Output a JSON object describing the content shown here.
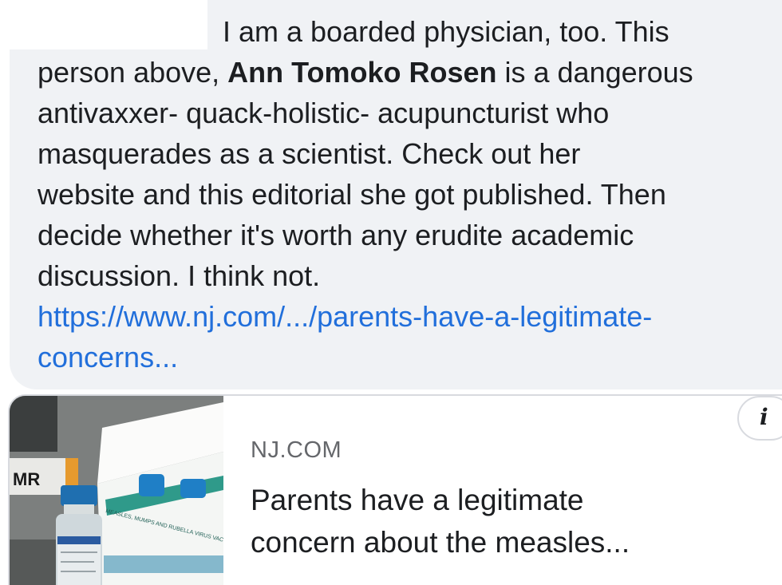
{
  "comment": {
    "line1": "I am a boarded physician, too. This",
    "line2_before": "person above, ",
    "author_mention": "Ann Tomoko Rosen",
    "line2_after": " is a dangerous",
    "line3": "antivaxxer- quack-holistic- acupuncturist who",
    "line4": "masquerades as a scientist. Check out her",
    "line5": "website and this editorial she got published. Then",
    "line6": "decide whether it's worth any erudite academic",
    "line7": "discussion. I think not.",
    "link_line1": "https://www.nj.com/.../parents-have-a-legitimate-",
    "link_line2": "concerns..."
  },
  "link_preview": {
    "domain": "NJ.COM",
    "title_line1": "Parents have a legitimate",
    "title_line2": "concern about the measles...",
    "thumbnail_vial_label": "MR",
    "thumbnail_box_text": "MEASLES, MUMPS AND RUBELLA VIRUS VACCINE"
  },
  "info_button": {
    "icon": "info-icon",
    "glyph": "i"
  },
  "colors": {
    "bubble": "#f0f2f5",
    "text": "#1c1e21",
    "link": "#216fdb",
    "secondary_text": "#65676b"
  }
}
